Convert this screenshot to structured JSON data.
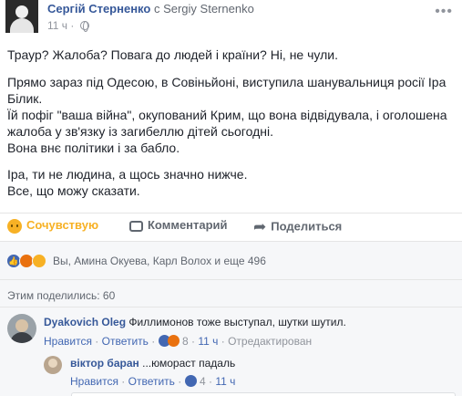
{
  "post": {
    "author": "Сергій Стерненко",
    "connector": "с",
    "target": "Sergiy Sternenko",
    "time": "11 ч",
    "more": "•••",
    "paragraphs": [
      [
        "Траур? Жалоба? Повага до людей і країни? Ні, не чули."
      ],
      [
        "Прямо зараз під Одесою, в Совіньйоні, виступила шанувальниця росії Іра",
        "Білик.",
        "Їй пофіг \"ваша війна\", окупований Крим, що вона відвідувала, і оголошена",
        "жалоба у зв'язку із загибеллю дітей сьогодні.",
        "Вона внє політики і за бабло."
      ],
      [
        "Іра, ти не людина, а щось значно нижче.",
        "Все, що можу сказати."
      ]
    ]
  },
  "actions": {
    "sympathy": "Сочувствую",
    "comment": "Комментарий",
    "share": "Поделиться"
  },
  "reactions": {
    "icons": [
      "like-reaction",
      "angry-reaction",
      "sad-reaction"
    ],
    "summary": "Вы, Амина Окуева, Карл Волох и еще 496"
  },
  "shares": {
    "text": "Этим поделились: 60"
  },
  "comments": [
    {
      "author": "Dyakovich Oleg",
      "text": "Филлимонов тоже выступал, шутки шутил.",
      "like": "Нравится",
      "reply": "Ответить",
      "reaction_count": "8",
      "time": "11 ч",
      "edited": "Отредактирован"
    }
  ],
  "replies": [
    {
      "author": "віктор баран",
      "text": "...юмораст падаль",
      "like": "Нравится",
      "reply": "Ответить",
      "reaction_count": "4",
      "time": "11 ч"
    }
  ],
  "colors": {
    "link": "#365899",
    "sympathy": "#f7b125",
    "like": "#4267b2",
    "angry": "#e9710f"
  }
}
